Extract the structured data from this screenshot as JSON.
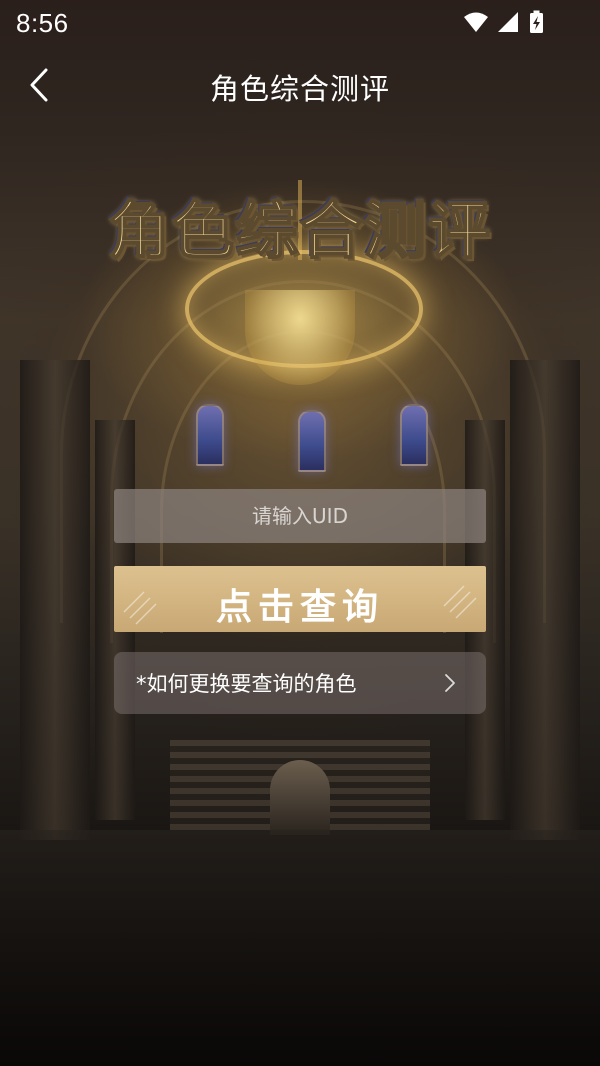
{
  "status_bar": {
    "time": "8:56",
    "icons": [
      "wifi-icon",
      "cellular-signal-icon",
      "battery-charging-icon"
    ]
  },
  "nav": {
    "title": "角色综合测评",
    "back_icon": "chevron-left-icon"
  },
  "hero": {
    "title": "角色综合测评"
  },
  "form": {
    "uid_placeholder": "请输入UID",
    "uid_value": "",
    "query_button_label": "点击查询"
  },
  "help": {
    "label": "*如何更换要查询的角色",
    "chevron_icon": "chevron-right-icon"
  },
  "colors": {
    "hero_title": "#f3d99a",
    "button_gold": "#d2b480",
    "input_bg": "#8c827d",
    "text": "#ffffff"
  }
}
